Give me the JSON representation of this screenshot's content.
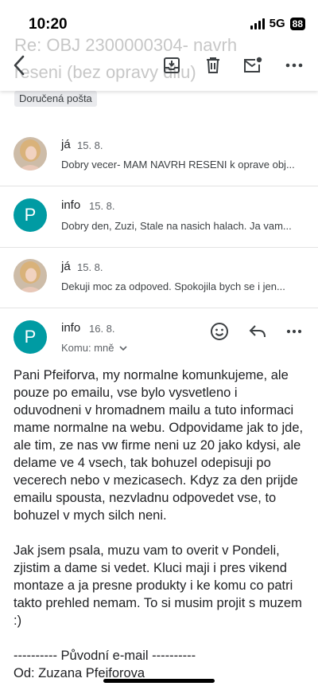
{
  "status_bar": {
    "time": "10:20",
    "network": "5G",
    "battery": "88"
  },
  "header": {
    "subject_line1": "Re: OBJ 2300000304- navrh",
    "subject_line2": "reseni (bez opravy dilu)"
  },
  "label": "Doručená pošta",
  "messages": [
    {
      "sender": "já",
      "date": "15. 8.",
      "snippet": "Dobry vecer- MAM NAVRH RESENI k oprave obj..."
    },
    {
      "sender": "info",
      "date": "15. 8.",
      "avatar_letter": "P",
      "snippet": "Dobry den, Zuzi, Stale na nasich halach. Ja vam..."
    },
    {
      "sender": "já",
      "date": "15. 8.",
      "snippet": "Dekuji moc za odpoved. Spokojila bych se i jen..."
    }
  ],
  "open_message": {
    "sender": "info",
    "date": "16. 8.",
    "avatar_letter": "P",
    "to_label": "Komu: mně",
    "body": "Pani Pfeiforva, my normalne komunkujeme, ale pouze po emailu, vse bylo vysvetleno i oduvodneni v hromadnem mailu a tuto informaci mame normalne na webu. Odpovidame jak to jde, ale tim, ze nas vw firme neni uz 20 jako kdysi, ale delame ve 4 vsech, tak bohuzel odepisuji po vecerech nebo v mezicasech. Kdyz za den prijde emailu spousta, nezvladnu odpovedet vse, to bohuzel v mych silch neni.\n\nJak jsem psala, muzu vam to overit v Pondeli, zjistim a dame si vedet. Kluci maji i pres vikend montaze a ja presne produkty i ke komu co patri takto prehled nemam. To si musim projit s muzem :)\n\n---------- Původní e-mail ----------\nOd: Zuzana Pfeiforova"
  },
  "colors": {
    "avatar_info": "#009ba3",
    "chip_bg": "#e9eaed"
  }
}
